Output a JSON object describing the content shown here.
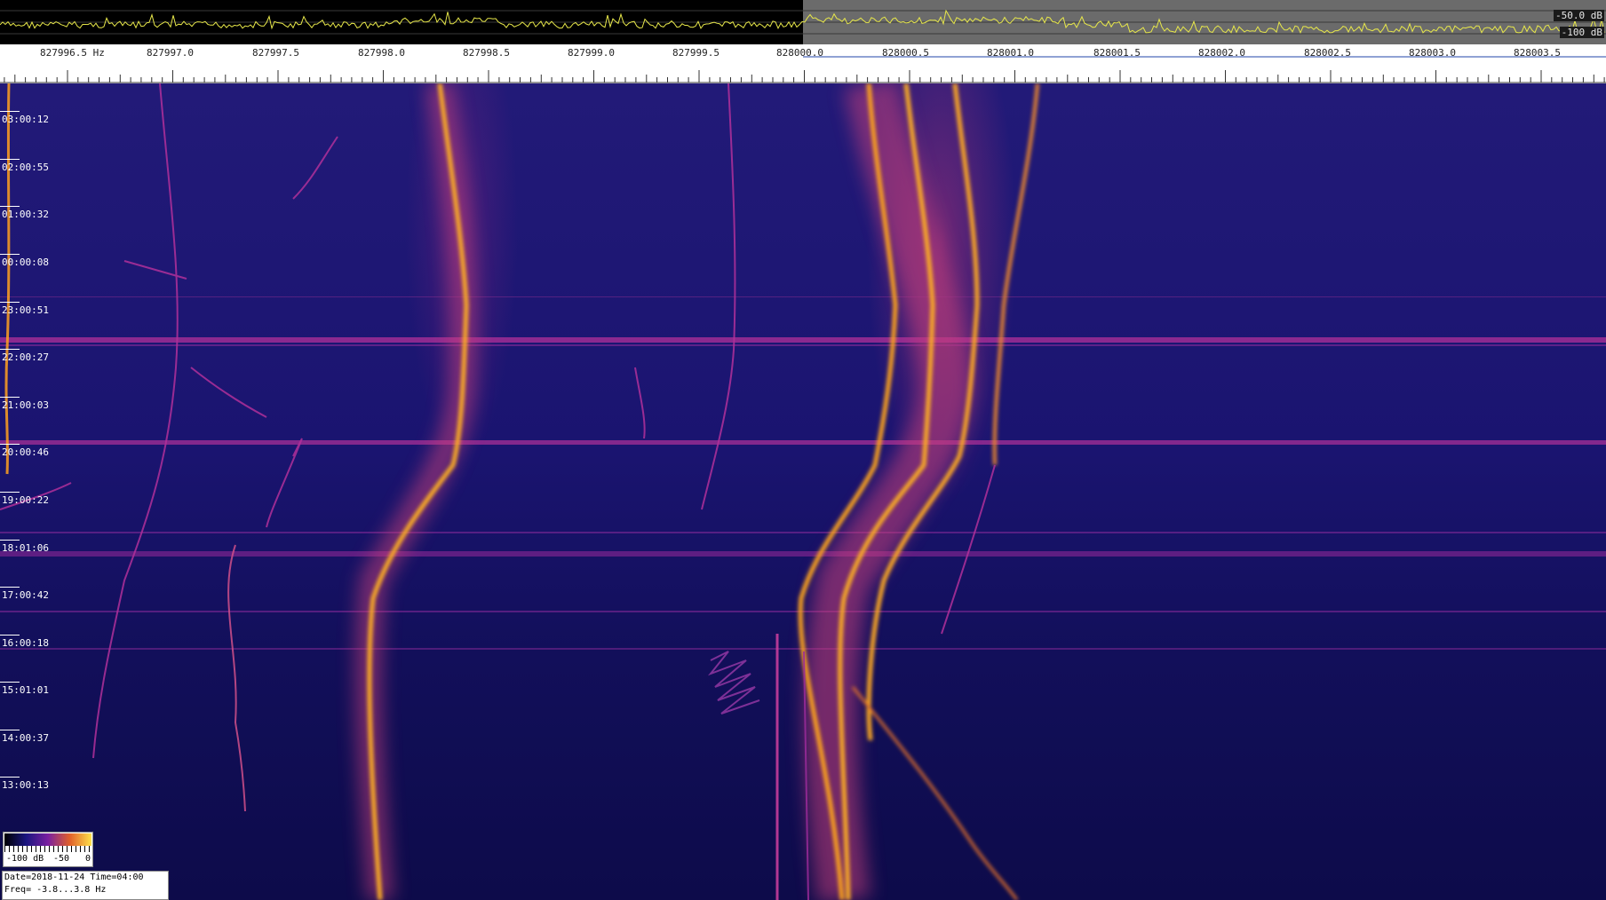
{
  "spectrum": {
    "db_top": "-50.0 dB",
    "db_bottom": "-100 dB",
    "trace_color": "#e8e84a"
  },
  "freq_scale": {
    "labels": [
      "827996.5 Hz",
      "827997.0",
      "827997.5",
      "827998.0",
      "827998.5",
      "827999.0",
      "827999.5",
      "828000.0",
      "828000.5",
      "828001.0",
      "828001.5",
      "828002.0",
      "828002.5",
      "828003.0",
      "828003.5"
    ]
  },
  "time_axis": {
    "labels": [
      "03:00:12",
      "02:00:55",
      "01:00:32",
      "00:00:08",
      "23:00:51",
      "22:00:27",
      "21:00:03",
      "20:00:46",
      "19:00:22",
      "18:01:06",
      "17:00:42",
      "16:00:18",
      "15:01:01",
      "14:00:37",
      "13:00:13"
    ]
  },
  "palette": {
    "min_label": "-100 dB",
    "mid_label": "-50",
    "max_label": "0",
    "colors": [
      "#000000",
      "#1a1680",
      "#7a1fa0",
      "#e0602a",
      "#ffe04a"
    ]
  },
  "info": {
    "line1": "Date=2018-11-24 Time=04:00",
    "line2": "Freq= -3.8...3.8 Hz"
  },
  "colors": {
    "background": "#10106a",
    "trace_bright": "#ffb020",
    "trace_dim": "#b0309a"
  }
}
